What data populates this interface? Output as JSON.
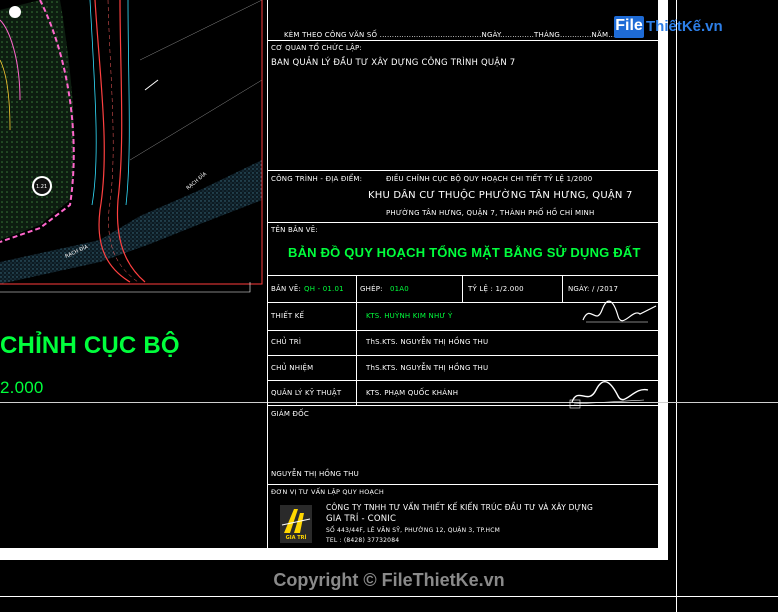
{
  "watermark": {
    "logo_initial": "File",
    "logo_rest": "ThiếtKế.vn"
  },
  "left_panel": {
    "title_partial": "CHỈNH CỤC BỘ",
    "scale_partial": "2.000",
    "road_labels": [
      "RẠCH ĐỈA",
      "RẠCH ĐỈA"
    ],
    "lot_label": "1.21"
  },
  "sheet": {
    "ref_line": "KÈM THEO CÔNG VĂN SỐ ..........................................NGÀY..............THÁNG.............NĂM.............",
    "agency_label": "CƠ QUAN TỔ CHỨC LẬP:",
    "agency_value": "BAN QUẢN LÝ ĐẦU TƯ XÂY DỰNG CÔNG TRÌNH QUẬN 7",
    "project_label": "CÔNG TRÌNH - ĐỊA ĐIỂM:",
    "project_line1": "ĐIỀU CHỈNH CỤC BỘ QUY HOẠCH CHI TIẾT TỶ LỆ 1/2000",
    "project_line2": "KHU DÂN CƯ THUỘC PHƯỜNG TÂN HƯNG, QUẬN 7",
    "project_line3": "PHƯỜNG TÂN HƯNG, QUẬN 7, THÀNH PHỐ HỒ CHÍ MINH",
    "drawing_label": "TÊN BẢN VẼ:",
    "drawing_title": "BẢN ĐỒ QUY HOẠCH TỔNG MẶT BẰNG SỬ DỤNG ĐẤT",
    "info_row": {
      "ban_ve_label": "BẢN VẼ:",
      "ban_ve_value": "QH - 01.01",
      "ghep_label": "GHÉP:",
      "ghep_value": "01A0",
      "ty_le": "TỶ LỆ : 1/2.000",
      "ngay": "NGÀY:          /     /2017"
    },
    "staff": [
      {
        "role": "THIẾT KẾ",
        "name": "KTS. HUỲNH KIM NHƯ Ý",
        "green": true
      },
      {
        "role": "CHỦ TRÌ",
        "name": "ThS.KTS. NGUYỄN THỊ HỒNG THU",
        "green": false
      },
      {
        "role": "CHỦ NHIỆM",
        "name": "ThS.KTS. NGUYỄN THỊ HỒNG THU",
        "green": false
      },
      {
        "role": "QUẢN LÝ KỸ THUẬT",
        "name": "KTS. PHẠM QUỐC KHÁNH",
        "green": false
      }
    ],
    "director_label": "GIÁM ĐỐC",
    "director_name": "NGUYỄN THỊ HỒNG THU",
    "consultant_label": "ĐƠN VỊ TƯ VẤN LẬP QUY HOẠCH",
    "company_name_1": "CÔNG TY TNHH TƯ VẤN THIẾT KẾ KIẾN TRÚC ĐẦU TƯ VÀ XÂY DỰNG",
    "company_name_2": "GIA TRÍ - CONIC",
    "company_address": "SỐ 443/44F, LÊ VĂN SỸ, PHƯỜNG 12, QUẬN 3, TP.HCM",
    "company_phone": "TEL : (8428) 37732084",
    "company_logo_text": "GIA TRÍ"
  },
  "footer": {
    "copyright": "Copyright © FileThietKe.vn"
  },
  "colors": {
    "green": "#00ff3c",
    "red": "#ff3b3b",
    "white": "#ffffff",
    "logo_blue": "#1e6bd6"
  }
}
